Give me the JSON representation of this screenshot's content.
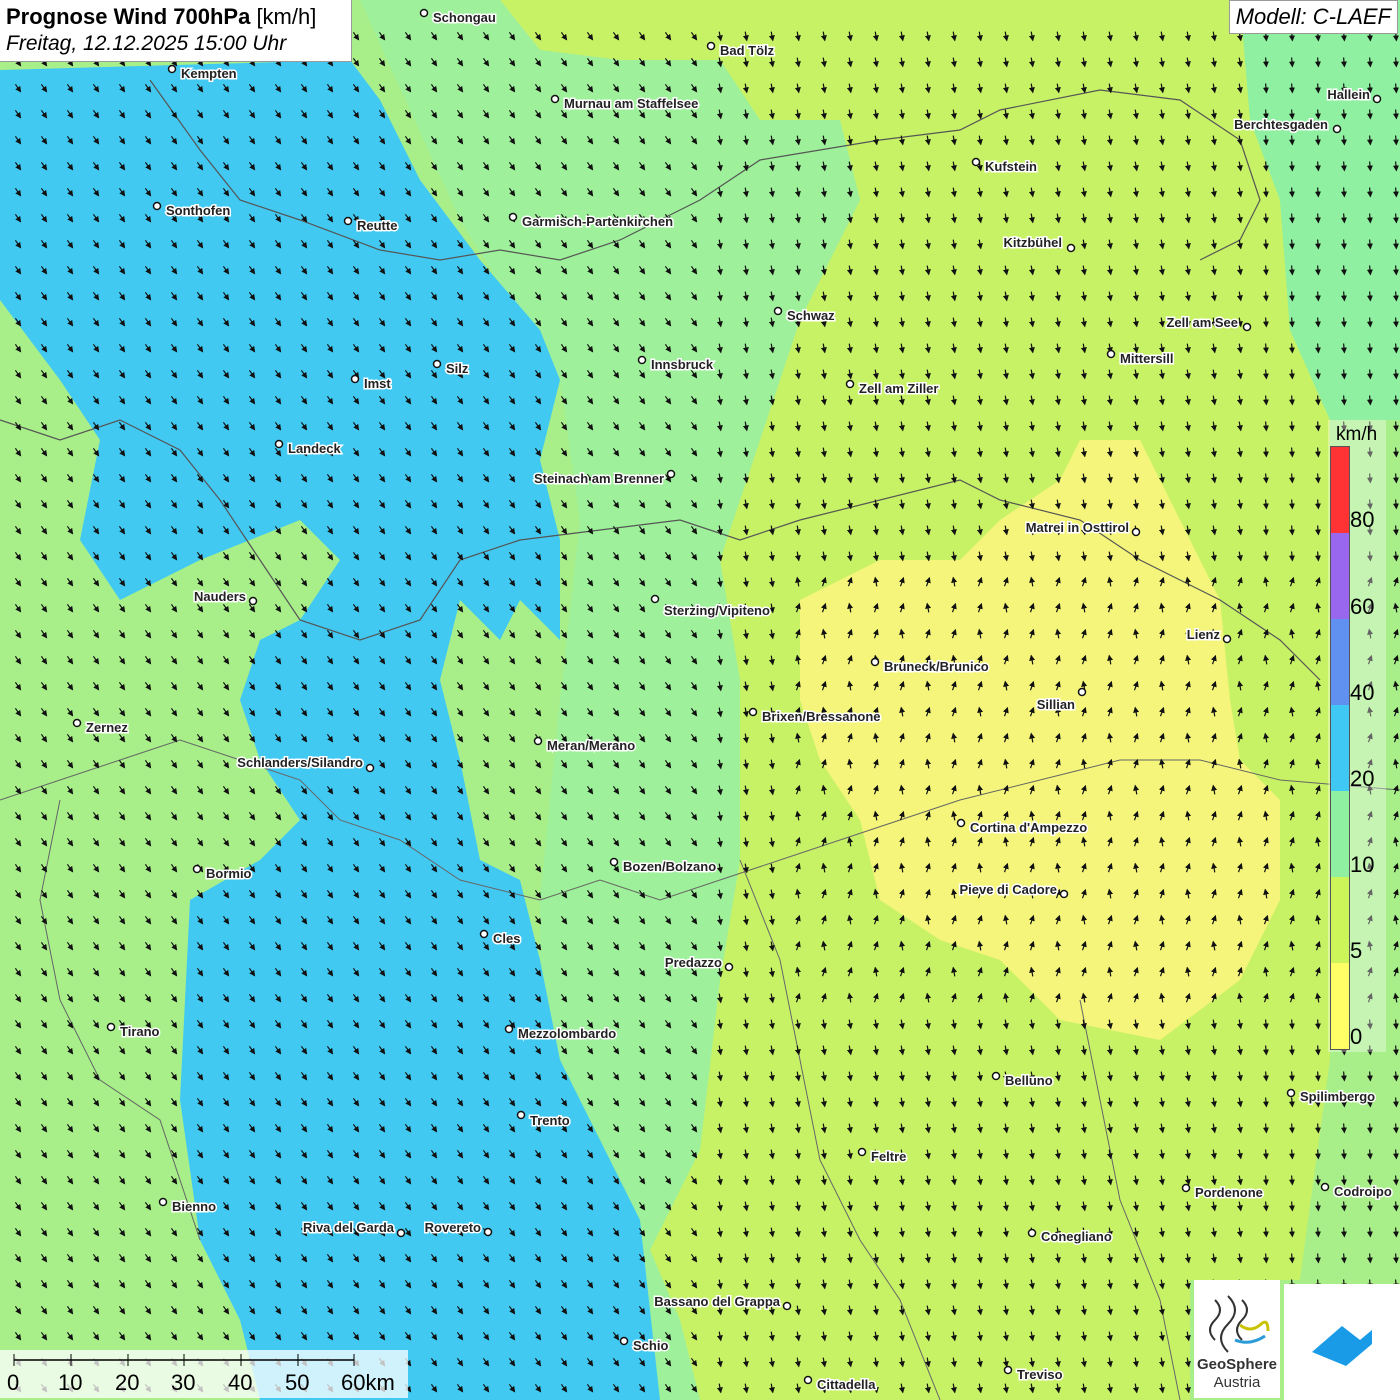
{
  "title": {
    "main": "Prognose Wind 700hPa",
    "unit": "[km/h]",
    "date": "Freitag, 12.12.2025 15:00 Uhr"
  },
  "model": "Modell: C-LAEF",
  "legend": {
    "unit": "km/h",
    "labels": [
      "80",
      "60",
      "40",
      "20",
      "10",
      "5",
      "0"
    ],
    "colors": {
      "0_5": "#ffff66",
      "5_10": "#ccf55a",
      "10_20": "#8ef0a0",
      "20_40": "#3fc8f4",
      "40_60": "#6090f0",
      "60_80": "#9966ee",
      "80_plus": "#ff3333"
    }
  },
  "scale": {
    "labels": [
      "0",
      "10",
      "20",
      "30",
      "40",
      "50",
      "60km"
    ]
  },
  "logo": {
    "line1": "GeoSphere",
    "line2": "Austria"
  },
  "cities": [
    {
      "name": "Schongau"
    },
    {
      "name": "Bad Tölz"
    },
    {
      "name": "Kempten"
    },
    {
      "name": "Murnau am Staffelsee"
    },
    {
      "name": "Hallein"
    },
    {
      "name": "Berchtesgaden"
    },
    {
      "name": "Kufstein"
    },
    {
      "name": "Sonthofen"
    },
    {
      "name": "Reutte"
    },
    {
      "name": "Garmisch-Partenkirchen"
    },
    {
      "name": "Kitzbühel"
    },
    {
      "name": "Schwaz"
    },
    {
      "name": "Zell am See"
    },
    {
      "name": "Mittersill"
    },
    {
      "name": "Innsbruck"
    },
    {
      "name": "Silz"
    },
    {
      "name": "Imst"
    },
    {
      "name": "Zell am Ziller"
    },
    {
      "name": "Landeck"
    },
    {
      "name": "Steinach am Brenner"
    },
    {
      "name": "Matrei in Osttirol"
    },
    {
      "name": "Nauders"
    },
    {
      "name": "Sterzing/Vipiteno"
    },
    {
      "name": "Lienz"
    },
    {
      "name": "Bruneck/Brunico"
    },
    {
      "name": "Sillian"
    },
    {
      "name": "Brixen/Bressanone"
    },
    {
      "name": "Zernez"
    },
    {
      "name": "Meran/Merano"
    },
    {
      "name": "Schlanders/Silandro"
    },
    {
      "name": "Cortina d'Ampezzo"
    },
    {
      "name": "Bozen/Bolzano"
    },
    {
      "name": "Bormio"
    },
    {
      "name": "Pieve di Cadore"
    },
    {
      "name": "Cles"
    },
    {
      "name": "Predazzo"
    },
    {
      "name": "Tirano"
    },
    {
      "name": "Mezzolombardo"
    },
    {
      "name": "Belluno"
    },
    {
      "name": "Spilimbergo"
    },
    {
      "name": "Trento"
    },
    {
      "name": "Feltre"
    },
    {
      "name": "Bienno"
    },
    {
      "name": "Pordenone"
    },
    {
      "name": "Codroipo"
    },
    {
      "name": "Riva del Garda"
    },
    {
      "name": "Rovereto"
    },
    {
      "name": "Conegliano"
    },
    {
      "name": "Bassano del Grappa"
    },
    {
      "name": "Schio"
    },
    {
      "name": "Treviso"
    },
    {
      "name": "Cittadella"
    }
  ]
}
